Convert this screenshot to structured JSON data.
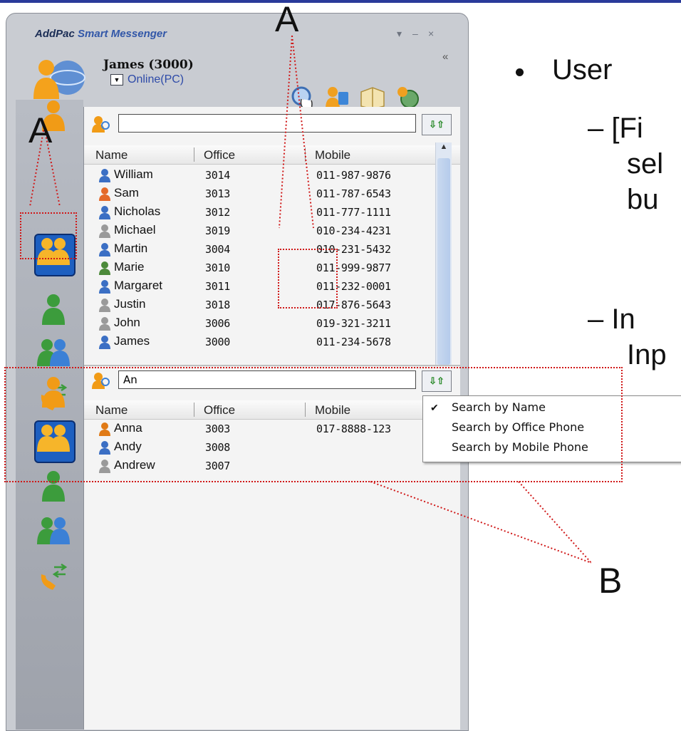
{
  "window": {
    "brand": "AddPac",
    "product": "Smart Messenger",
    "controls": [
      "▾",
      "–",
      "×"
    ],
    "collapse": "«"
  },
  "user": {
    "name": "James (3000)",
    "status": "Online(PC)"
  },
  "toolbar": {
    "icons": [
      "search-icon",
      "contacts-icon",
      "message-icon",
      "settings-icon"
    ]
  },
  "columns": {
    "name": "Name",
    "office": "Office",
    "mobile": "Mobile"
  },
  "top_list": {
    "search_value": "",
    "rows": [
      {
        "name": "William",
        "office": "3014",
        "mobile": "011-987-9876"
      },
      {
        "name": "Sam",
        "office": "3013",
        "mobile": "011-787-6543"
      },
      {
        "name": "Nicholas",
        "office": "3012",
        "mobile": "011-777-1111"
      },
      {
        "name": "Michael",
        "office": "3019",
        "mobile": "010-234-4231"
      },
      {
        "name": "Martin",
        "office": "3004",
        "mobile": "010-231-5432"
      },
      {
        "name": "Marie",
        "office": "3010",
        "mobile": "011-999-9877"
      },
      {
        "name": "Margaret",
        "office": "3011",
        "mobile": "011-232-0001"
      },
      {
        "name": "Justin",
        "office": "3018",
        "mobile": "017-876-5643"
      },
      {
        "name": "John",
        "office": "3006",
        "mobile": "019-321-3211"
      },
      {
        "name": "James",
        "office": "3000",
        "mobile": "011-234-5678"
      }
    ]
  },
  "bottom_list": {
    "search_value": "An",
    "rows": [
      {
        "name": "Anna",
        "office": "3003",
        "mobile": "017-8888-123"
      },
      {
        "name": "Andy",
        "office": "3008",
        "mobile": ""
      },
      {
        "name": "Andrew",
        "office": "3007",
        "mobile": ""
      }
    ]
  },
  "search_menu": {
    "items": [
      "Search by Name",
      "Search by Office Phone",
      "Search by Mobile Phone"
    ],
    "checked": "Search by Name"
  },
  "annotations": {
    "a_top": "A",
    "a_left": "A",
    "b": "B"
  },
  "slide": {
    "bullet": "User",
    "dash1_line1": "– [Fi",
    "dash1_line2": "sel",
    "dash1_line3": "bu",
    "dash2_line1": "– In",
    "dash2_line2": "Inp"
  },
  "colors": {
    "annotation": "#d01818",
    "status_link": "#2d4aa8",
    "selected_tab": "#1d5fc0"
  }
}
